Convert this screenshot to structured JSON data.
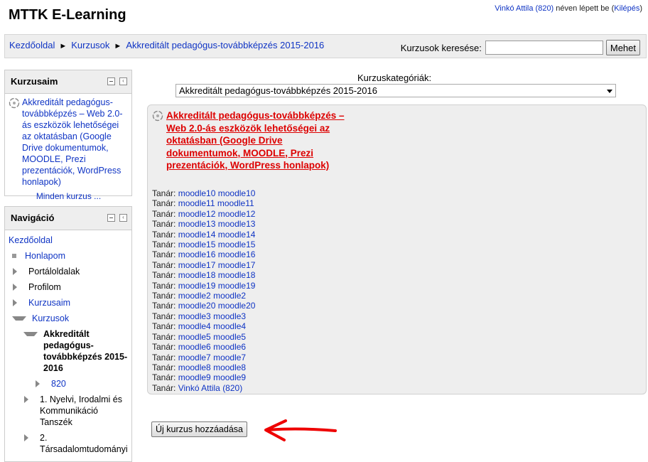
{
  "header": {
    "site_title": "MTTK E-Learning",
    "user_name": "Vinkó Attila (820)",
    "logged_in_text": " néven lépett be (",
    "logout": "Kilépés",
    "logout_close": ")"
  },
  "breadcrumb": {
    "home": "Kezdőoldal",
    "courses": "Kurzusok",
    "category": "Akkreditált pedagógus-továbbképzés 2015-2016",
    "separator": "►"
  },
  "search": {
    "label": "Kurzusok keresése:",
    "value": "",
    "button": "Mehet"
  },
  "my_courses_block": {
    "title": "Kurzusaim",
    "course": "Akkreditált pedagógus-továbbképzés – Web 2.0-ás eszközök lehetőségei az oktatásban (Google Drive dokumentumok, MOODLE, Prezi prezentációk, WordPress honlapok)",
    "all_courses": "Minden kurzus ..."
  },
  "navigation_block": {
    "title": "Navigáció",
    "home": "Kezdőoldal",
    "items": [
      {
        "label": "Honlapom"
      },
      {
        "label": "Portáloldalak"
      },
      {
        "label": "Profilom"
      },
      {
        "label": "Kurzusaim"
      },
      {
        "label": "Kurzusok"
      }
    ],
    "category_current": "Akkreditált pedagógus-továbbképzés 2015-2016",
    "course_short": "820",
    "dept1": "1. Nyelvi, Irodalmi és Kommunikáció Tanszék",
    "dept2": "2. Társadalomtudományi"
  },
  "category": {
    "label": "Kurzuskategóriák:",
    "selected": "Akkreditált pedagógus-továbbképzés 2015-2016"
  },
  "course": {
    "title": "Akkreditált pedagógus-továbbképzés – Web 2.0-ás eszközök lehetőségei az oktatásban (Google Drive dokumentumok, MOODLE, Prezi prezentációk, WordPress honlapok)",
    "teacher_label": "Tanár:",
    "teachers": [
      "moodle10 moodle10",
      "moodle11 moodle11",
      "moodle12 moodle12",
      "moodle13 moodle13",
      "moodle14 moodle14",
      "moodle15 moodle15",
      "moodle16 moodle16",
      "moodle17 moodle17",
      "moodle18 moodle18",
      "moodle19 moodle19",
      "moodle2 moodle2",
      "moodle20 moodle20",
      "moodle3 moodle3",
      "moodle4 moodle4",
      "moodle5 moodle5",
      "moodle6 moodle6",
      "moodle7 moodle7",
      "moodle8 moodle8",
      "moodle9 moodle9",
      "Vinkó Attila (820)"
    ]
  },
  "add_course_button": "Új kurzus hozzáadása",
  "colors": {
    "link": "#0f34c4",
    "course_title": "#dd0000",
    "arrow": "#ee0000",
    "panel_bg": "#eeeeee"
  }
}
